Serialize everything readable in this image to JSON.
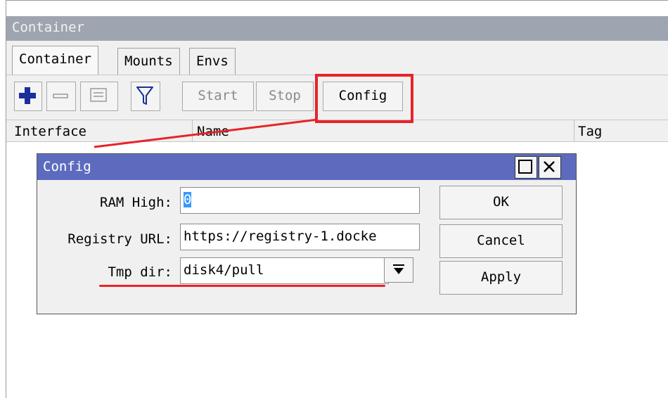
{
  "window": {
    "title": "Container"
  },
  "tabs": [
    {
      "label": "Container"
    },
    {
      "label": "Mounts"
    },
    {
      "label": "Envs"
    }
  ],
  "toolbar": {
    "add_icon": "plus-icon",
    "remove_icon": "minus-icon",
    "comment_icon": "comment-icon",
    "filter_icon": "filter-icon",
    "start_label": "Start",
    "stop_label": "Stop",
    "config_label": "Config"
  },
  "table": {
    "columns": [
      "Interface",
      "Name",
      "Tag"
    ]
  },
  "dialog": {
    "title": "Config",
    "fields": {
      "ram_high": {
        "label": "RAM High:",
        "value": "0"
      },
      "registry_url": {
        "label": "Registry URL:",
        "value": "https://registry-1.docke"
      },
      "tmp_dir": {
        "label": "Tmp dir:",
        "value": "disk4/pull"
      }
    },
    "buttons": {
      "ok": "OK",
      "cancel": "Cancel",
      "apply": "Apply"
    }
  },
  "colors": {
    "highlight": "#e8232a",
    "dialog_title_bar": "#5d6bbf",
    "window_title_bar": "#9ea5b0"
  }
}
